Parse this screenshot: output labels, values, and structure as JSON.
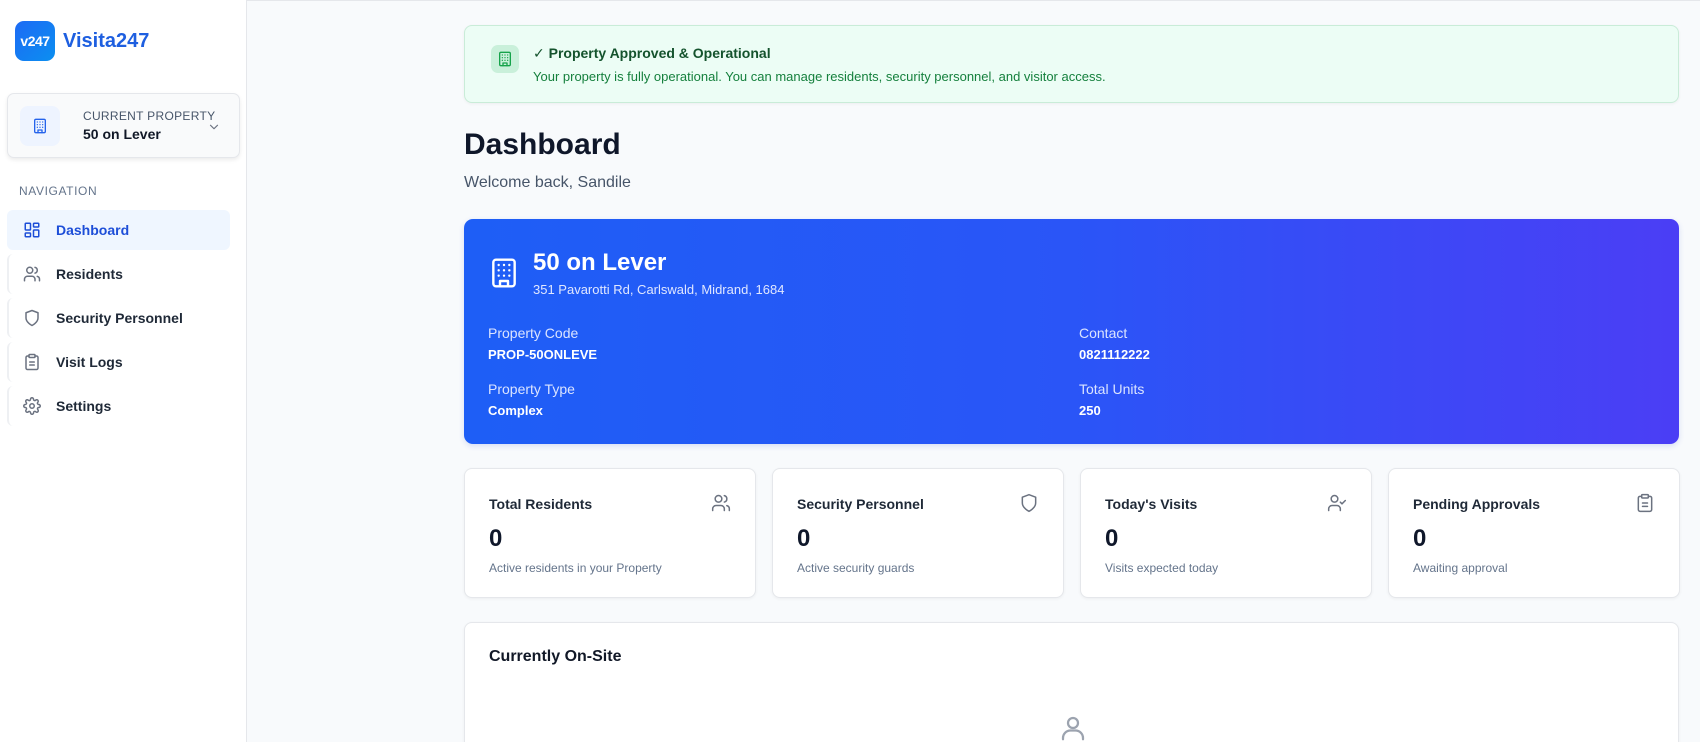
{
  "brand": {
    "badge": "v247",
    "name": "Visita247"
  },
  "property_switcher": {
    "label": "CURRENT PROPERTY",
    "value": "50 on Lever"
  },
  "nav": {
    "title": "NAVIGATION",
    "items": [
      {
        "label": "Dashboard",
        "icon": "dashboard-icon",
        "active": true
      },
      {
        "label": "Residents",
        "icon": "users-icon",
        "active": false
      },
      {
        "label": "Security Personnel",
        "icon": "shield-icon",
        "active": false
      },
      {
        "label": "Visit Logs",
        "icon": "clipboard-icon",
        "active": false
      },
      {
        "label": "Settings",
        "icon": "gear-icon",
        "active": false
      }
    ]
  },
  "banner": {
    "title": "✓ Property Approved & Operational",
    "message": "Your property is fully operational. You can manage residents, security personnel, and visitor access."
  },
  "page": {
    "title": "Dashboard",
    "welcome": "Welcome back, Sandile"
  },
  "property": {
    "name": "50 on Lever",
    "address": "351 Pavarotti Rd, Carlswald, Midrand, 1684",
    "fields": [
      {
        "label": "Property Code",
        "value": "PROP-50ONLEVE"
      },
      {
        "label": "Contact",
        "value": "0821112222"
      },
      {
        "label": "Property Type",
        "value": "Complex"
      },
      {
        "label": "Total Units",
        "value": "250"
      }
    ]
  },
  "stats": [
    {
      "label": "Total Residents",
      "value": "0",
      "sub": "Active residents in your Property",
      "icon": "users-icon"
    },
    {
      "label": "Security Personnel",
      "value": "0",
      "sub": "Active security guards",
      "icon": "shield-icon"
    },
    {
      "label": "Today's Visits",
      "value": "0",
      "sub": "Visits expected today",
      "icon": "user-check-icon"
    },
    {
      "label": "Pending Approvals",
      "value": "0",
      "sub": "Awaiting approval",
      "icon": "clipboard-icon"
    }
  ],
  "onsite": {
    "title": "Currently On-Site"
  },
  "colors": {
    "accent": "#1d4ed8",
    "hero_start": "#1e5ef6",
    "hero_end": "#4b3ef5",
    "success_bg": "#ecfdf5",
    "success_text": "#15803d"
  }
}
